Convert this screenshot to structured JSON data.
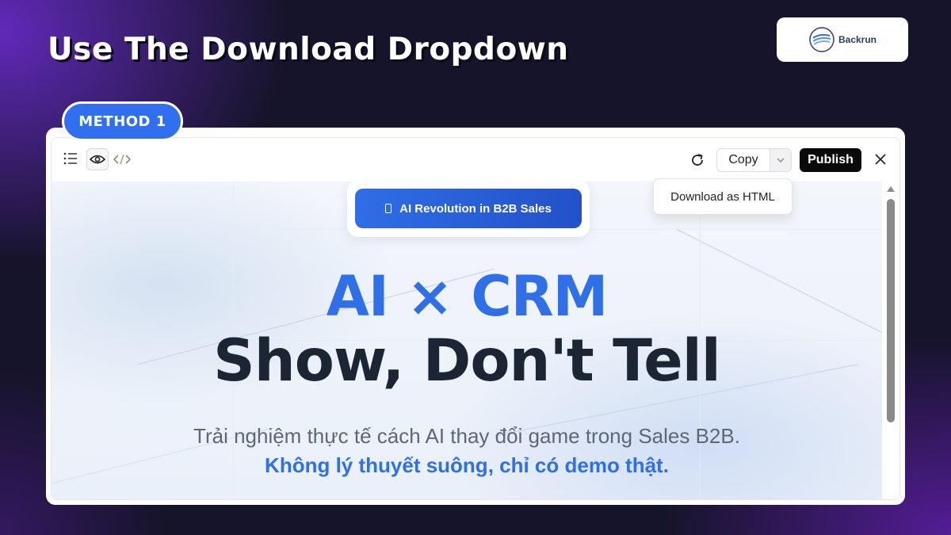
{
  "headline": "Use The Download Dropdown",
  "brand": {
    "name": "Backrun",
    "icon": "backrun-logo-icon"
  },
  "method_label": "METHOD 1",
  "toolbar": {
    "list_icon": "list-icon",
    "preview_icon": "eye-icon",
    "code_icon": "code-icon",
    "refresh_icon": "refresh-icon",
    "copy_label": "Copy",
    "caret_icon": "chevron-down-icon",
    "publish_label": "Publish",
    "close_icon": "close-icon"
  },
  "dropdown": {
    "items": [
      "Download as HTML"
    ]
  },
  "preview": {
    "badge_label": "AI Revolution in B2B Sales",
    "title": "AI × CRM",
    "subtitle": "Show, Don't Tell",
    "description_line1": "Trải nghiệm thực tế cách AI thay đổi game trong Sales B2B.",
    "description_line2": "Không lý thuyết suông, chỉ có demo thật."
  },
  "colors": {
    "accent_blue": "#2f6fe8",
    "publish_bg": "#0a0a0a",
    "dark_text": "#1b2534"
  }
}
